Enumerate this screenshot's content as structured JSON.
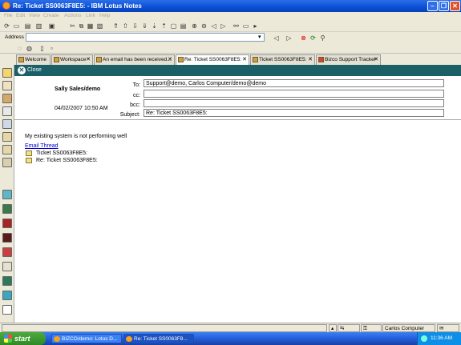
{
  "window": {
    "title": "Re: Ticket SS0063F8E5: - IBM Lotus Notes"
  },
  "menu": [
    "File",
    "Edit",
    "View",
    "Create",
    "Actions",
    "Link",
    "Help"
  ],
  "address": {
    "label": "Address",
    "value": ""
  },
  "tabs": [
    {
      "label": "Welcome"
    },
    {
      "label": "Workspace"
    },
    {
      "label": "An email has been received..."
    },
    {
      "label": "Re: Ticket SS0063F8E5:"
    },
    {
      "label": "Ticket SS0063F8E5:"
    },
    {
      "label": "Bizco Support Tracker"
    }
  ],
  "actionbar": {
    "close_label": "Close"
  },
  "memo": {
    "sender": "Sally Sales/demo",
    "datetime": "04/02/2007 10:50 AM",
    "to_label": "To:",
    "to_value": "Support@demo, Carlos Computer/demo@demo",
    "cc_label": "cc:",
    "cc_value": "",
    "bcc_label": "bcc:",
    "bcc_value": "",
    "subject_label": "Subject:",
    "subject_value": "Re: Ticket SS0063F8E5:",
    "body": "My existing system is not performing well",
    "thread_link": "Email Thread",
    "thread_items": [
      "Ticket SS0063F8E5:",
      "Re: Ticket SS0063F8E5:"
    ]
  },
  "status": {
    "location": "Carlos Computer"
  },
  "taskbar": {
    "start_label": "start",
    "buttons": [
      {
        "label": "BIZCO/demo: Lotus D..."
      },
      {
        "label": "Re: Ticket SS0063F8..."
      }
    ],
    "clock": "11:36 AM"
  }
}
